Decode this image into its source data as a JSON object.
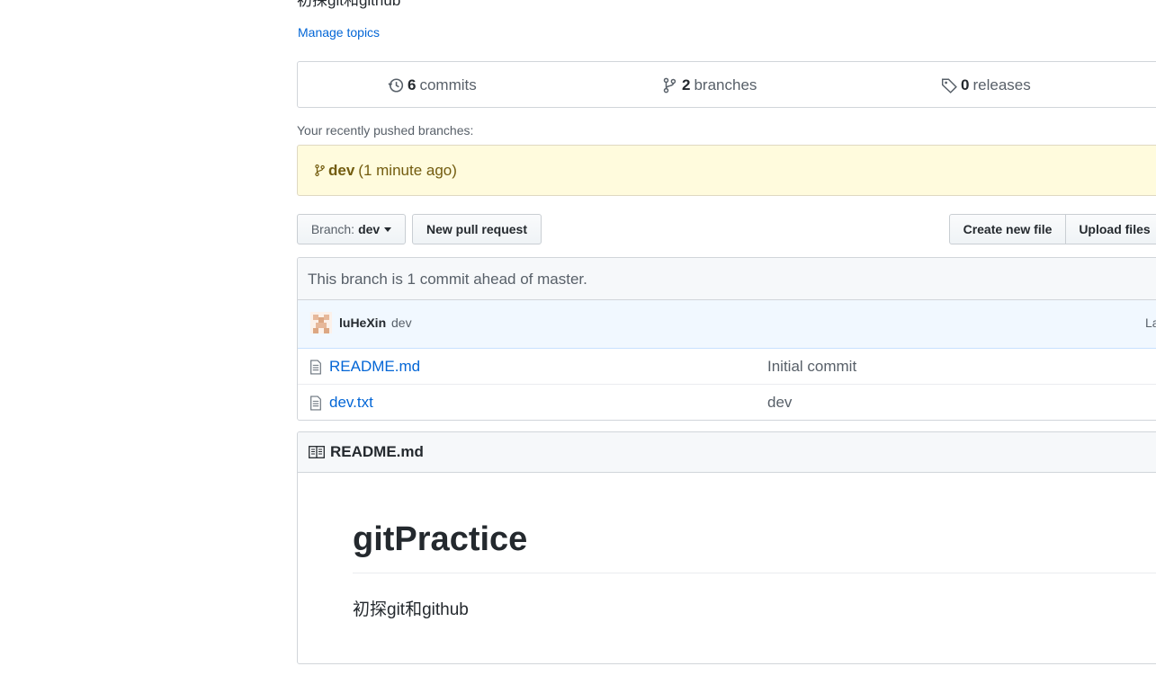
{
  "repo": {
    "description": "初探git和github",
    "manage_topics": "Manage topics"
  },
  "summary": {
    "commits_count": "6",
    "commits_label": "commits",
    "branches_count": "2",
    "branches_label": "branches",
    "releases_count": "0",
    "releases_label": "releases"
  },
  "recent": {
    "label": "Your recently pushed branches:",
    "branch": "dev",
    "time": "(1 minute ago)"
  },
  "toolbar": {
    "branch_prefix": "Branch:",
    "branch_name": "dev",
    "new_pull_request": "New pull request",
    "create_new_file": "Create new file",
    "upload_files": "Upload files"
  },
  "files": {
    "ahead_message": "This branch is 1 commit ahead of master.",
    "latest_commit": {
      "author": "luHeXin",
      "message": "dev",
      "latest_label": "La"
    },
    "rows": [
      {
        "name": "README.md",
        "message": "Initial commit"
      },
      {
        "name": "dev.txt",
        "message": "dev"
      }
    ]
  },
  "readme": {
    "header": "README.md",
    "title": "gitPractice",
    "body": "初探git和github"
  },
  "colors": {
    "link": "#0366d6",
    "recent_bg": "#fffbdd",
    "commit_bar_bg": "#f1f8ff"
  }
}
